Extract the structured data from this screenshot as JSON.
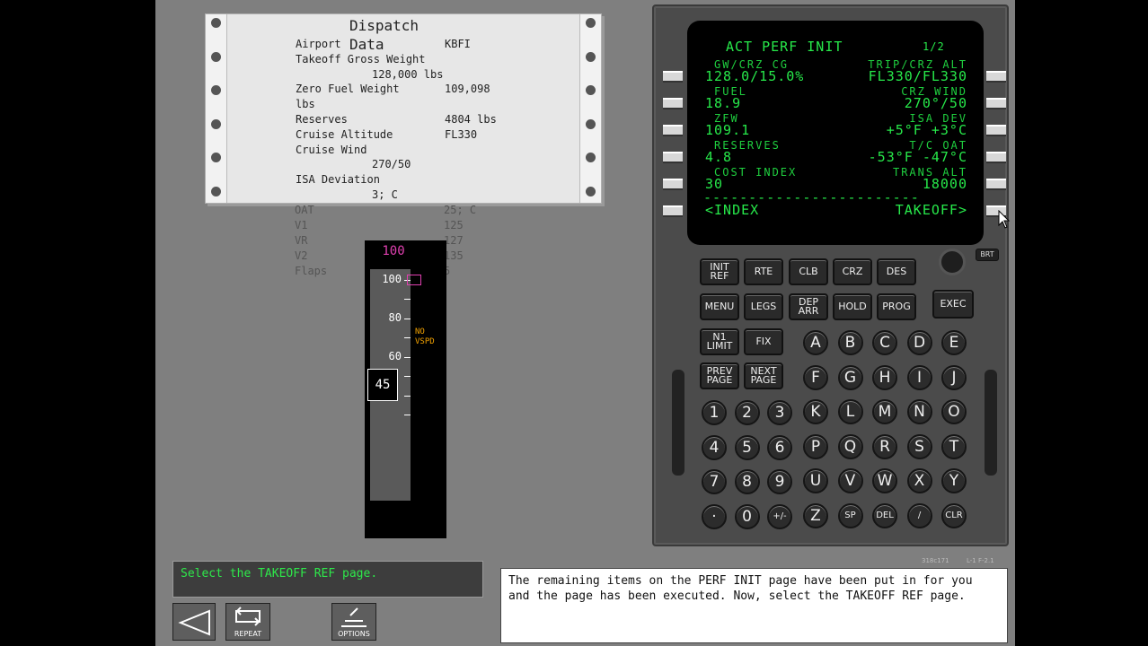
{
  "dispatch": {
    "title": "Dispatch",
    "title_word2": "Data",
    "rows": [
      {
        "label": "Airport",
        "value": "KBFI"
      },
      {
        "label": "Takeoff Gross Weight",
        "value": ""
      },
      {
        "label": "",
        "value": "128,000 lbs"
      },
      {
        "label": "Zero Fuel Weight",
        "value": "109,098"
      },
      {
        "label": "lbs",
        "value": ""
      },
      {
        "label": "Reserves",
        "value": "4804 lbs"
      },
      {
        "label": "Cruise Altitude",
        "value": "FL330"
      },
      {
        "label": "Cruise Wind",
        "value": ""
      },
      {
        "label": "",
        "value": "270/50"
      },
      {
        "label": "ISA Deviation",
        "value": ""
      },
      {
        "label": "",
        "value": "3; C"
      }
    ],
    "under_rows": [
      {
        "label": "OAT",
        "value": "25; C"
      },
      {
        "label": "V1",
        "value": "125"
      },
      {
        "label": "VR",
        "value": "127"
      },
      {
        "label": "V2",
        "value": "135"
      },
      {
        "label": "Flaps",
        "value": "5"
      }
    ]
  },
  "tape": {
    "top_value": "100",
    "ticks": [
      "100",
      "80",
      "60"
    ],
    "readout": "45",
    "no_vspd": "NO VSPD"
  },
  "cdu": {
    "title": "ACT PERF INIT",
    "page": "1/2",
    "lines": [
      {
        "l_small": "GW/CRZ CG",
        "r_small": "TRIP/CRZ ALT",
        "l_big": "128.0/15.0%",
        "r_big": "FL330/FL330"
      },
      {
        "l_small": "FUEL",
        "r_small": "CRZ WIND",
        "l_big": "18.9",
        "r_big": "270°/50"
      },
      {
        "l_small": "ZFW",
        "r_small": "ISA DEV",
        "l_big": "109.1",
        "r_big": "+5°F +3°C"
      },
      {
        "l_small": "RESERVES",
        "r_small": "T/C OAT",
        "l_big": "4.8",
        "r_big": "-53°F -47°C"
      },
      {
        "l_small": "COST INDEX",
        "r_small": "TRANS ALT",
        "l_big": "30",
        "r_big": "18000"
      }
    ],
    "dashes": "------------------------",
    "bottom_left": "<INDEX",
    "bottom_right": "TAKEOFF>",
    "brt": "BRT",
    "func_keys": [
      "INIT REF",
      "RTE",
      "CLB",
      "CRZ",
      "DES",
      "MENU",
      "LEGS",
      "DEP ARR",
      "HOLD",
      "PROG",
      "N1 LIMIT",
      "FIX",
      "PREV PAGE",
      "NEXT PAGE"
    ],
    "exec": "EXEC",
    "letters": [
      "A",
      "B",
      "C",
      "D",
      "E",
      "F",
      "G",
      "H",
      "I",
      "J",
      "K",
      "L",
      "M",
      "N",
      "O",
      "P",
      "Q",
      "R",
      "S",
      "T",
      "U",
      "V",
      "W",
      "X",
      "Y",
      "Z",
      "SP",
      "DEL",
      "/",
      "CLR"
    ],
    "digits": [
      "1",
      "2",
      "3",
      "4",
      "5",
      "6",
      "7",
      "8",
      "9",
      "·",
      "0",
      "+/-"
    ],
    "foot_left": "318c171",
    "foot_right": "L-1 F-2.1"
  },
  "prompt": "Select the TAKEOFF REF page.",
  "message": "The remaining items on the PERF INIT page have been put in for you and the page has been executed.  Now, select the TAKEOFF REF page.",
  "nav": {
    "repeat": "REPEAT",
    "options": "OPTIONS"
  }
}
